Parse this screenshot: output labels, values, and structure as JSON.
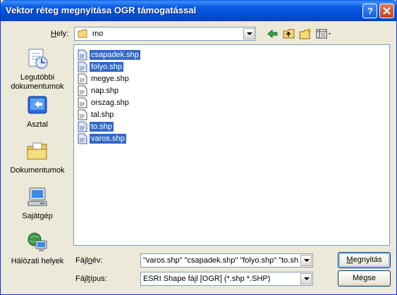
{
  "window": {
    "title": "Vektor réteg megnyitása OGR támogatással",
    "help_icon": "help-icon",
    "close_icon": "close-icon"
  },
  "location": {
    "label_first": "H",
    "label_rest": "ely:",
    "folder": "mo",
    "folder_icon": "folder-icon",
    "toolbar_icons": [
      "back-icon",
      "up-folder-icon",
      "new-folder-icon",
      "view-menu-icon"
    ]
  },
  "places": [
    {
      "label": "Legutóbbi dokumentumok",
      "icon": "recent-documents-icon"
    },
    {
      "label": "Asztal",
      "icon": "desktop-icon"
    },
    {
      "label": "Dokumentumok",
      "icon": "my-documents-icon"
    },
    {
      "label": "Sajátgép",
      "icon": "my-computer-icon"
    },
    {
      "label": "Hálózati helyek",
      "icon": "network-places-icon"
    }
  ],
  "files": [
    {
      "name": "csapadek.shp",
      "selected": true
    },
    {
      "name": "folyo.shp",
      "selected": true
    },
    {
      "name": "megye.shp",
      "selected": false
    },
    {
      "name": "nap.shp",
      "selected": false
    },
    {
      "name": "orszag.shp",
      "selected": false
    },
    {
      "name": "tal.shp",
      "selected": false
    },
    {
      "name": "to.shp",
      "selected": true
    },
    {
      "name": "varos.shp",
      "selected": true
    }
  ],
  "filename": {
    "label_pre": "Fájl",
    "label_u": "n",
    "label_post": "év:",
    "value": "\"varos.shp\" \"csapadek.shp\" \"folyo.shp\" \"to.sh"
  },
  "filetype": {
    "label_pre": "Fájl",
    "label_u": "t",
    "label_post": "ípus:",
    "value": "ESRI Shape fájl [OGR] (*.shp *.SHP)"
  },
  "buttons": {
    "open_u": "M",
    "open_rest": "egnyitás",
    "cancel": "Mégse"
  },
  "colors": {
    "selection": "#316ac5",
    "titlebar": "#0350d8",
    "dialog_bg": "#ece9d8"
  }
}
